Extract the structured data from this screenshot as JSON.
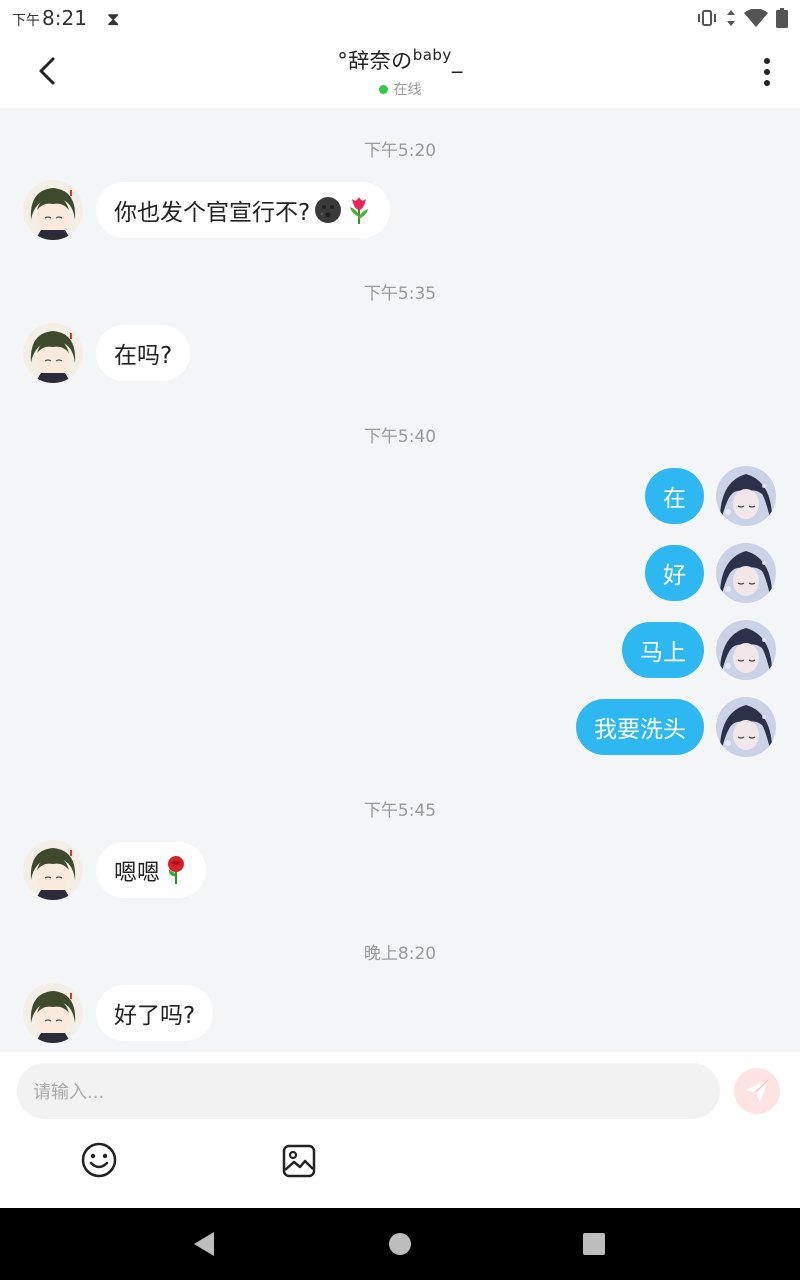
{
  "status_bar": {
    "ampm": "下午",
    "time": "8:21"
  },
  "header": {
    "title": "°辞奈の",
    "title_sup": "baby",
    "title_suffix": "_",
    "presence": "在线"
  },
  "messages": [
    {
      "type": "timestamp",
      "text": "下午5:20"
    },
    {
      "type": "message",
      "side": "in",
      "text": "你也发个官宣行不?",
      "emojis": [
        "dark-moon-face-emoji",
        "tulip-emoji"
      ]
    },
    {
      "type": "timestamp",
      "text": "下午5:35"
    },
    {
      "type": "message",
      "side": "in",
      "text": "在吗?"
    },
    {
      "type": "timestamp",
      "text": "下午5:40"
    },
    {
      "type": "message",
      "side": "out",
      "text": "在"
    },
    {
      "type": "message",
      "side": "out",
      "text": "好"
    },
    {
      "type": "message",
      "side": "out",
      "text": "马上"
    },
    {
      "type": "message",
      "side": "out",
      "text": "我要洗头"
    },
    {
      "type": "timestamp",
      "text": "下午5:45"
    },
    {
      "type": "message",
      "side": "in",
      "text": "嗯嗯",
      "emojis": [
        "rose-emoji"
      ]
    },
    {
      "type": "timestamp",
      "text": "晚上8:20"
    },
    {
      "type": "message",
      "side": "in",
      "text": "好了吗?"
    }
  ],
  "composer": {
    "placeholder": "请输入..."
  },
  "colors": {
    "bubble_out": "#2db8f2",
    "bubble_in": "#ffffff",
    "send_button": "#fde3e1",
    "presence": "#2ecc40"
  }
}
